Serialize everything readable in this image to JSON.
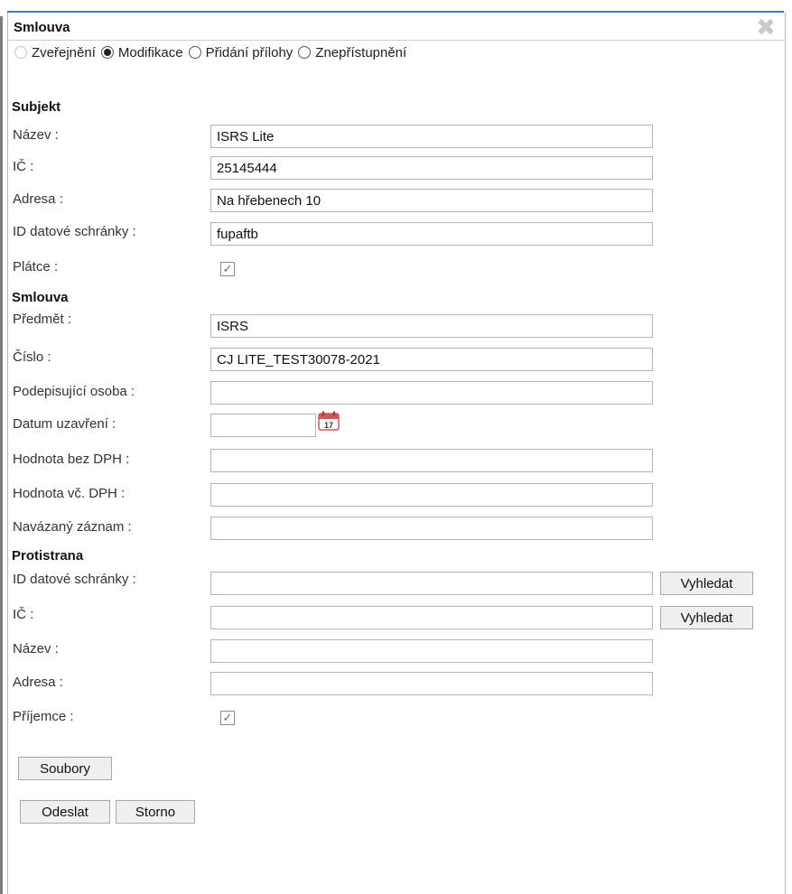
{
  "dialog": {
    "title": "Smlouva",
    "close_glyph": "✖"
  },
  "mode_options": [
    {
      "label": "Zveřejnění",
      "state": "disabled"
    },
    {
      "label": "Modifikace",
      "state": "checked"
    },
    {
      "label": "Přidání přílohy",
      "state": "unchecked"
    },
    {
      "label": "Znepřístupnění",
      "state": "unchecked"
    }
  ],
  "subjekt": {
    "heading": "Subjekt",
    "nazev_label": "Název :",
    "nazev_value": "ISRS Lite",
    "ic_label": "IČ :",
    "ic_value": "25145444",
    "adresa_label": "Adresa :",
    "adresa_value": "Na hřebenech 10",
    "ds_label": "ID datové schránky :",
    "ds_value": "fupaftb",
    "platce_label": "Plátce :",
    "platce_checked": true
  },
  "smlouva": {
    "heading": "Smlouva",
    "predmet_label": "Předmět :",
    "predmet_value": "ISRS",
    "cislo_label": "Číslo :",
    "cislo_value": "CJ LITE_TEST30078-2021",
    "osoba_label": "Podepisující osoba :",
    "osoba_value": "",
    "datum_label": "Datum uzavření :",
    "datum_value": "",
    "calendar_day": "17",
    "bez_dph_label": "Hodnota bez DPH :",
    "bez_dph_value": "",
    "vc_dph_label": "Hodnota vč. DPH :",
    "vc_dph_value": "",
    "zaznam_label": "Navázaný záznam :",
    "zaznam_value": ""
  },
  "protistrana": {
    "heading": "Protistrana",
    "ds_label": "ID datové schránky :",
    "ds_value": "",
    "ic_label": "IČ :",
    "ic_value": "",
    "nazev_label": "Název :",
    "nazev_value": "",
    "adresa_label": "Adresa :",
    "adresa_value": "",
    "prijemce_label": "Příjemce :",
    "prijemce_checked": true,
    "search_label": "Vyhledat"
  },
  "buttons": {
    "soubory": "Soubory",
    "odeslat": "Odeslat",
    "storno": "Storno"
  },
  "colors": {
    "accent_blue": "#2a7fd4",
    "calendar_red": "#d9534f"
  }
}
